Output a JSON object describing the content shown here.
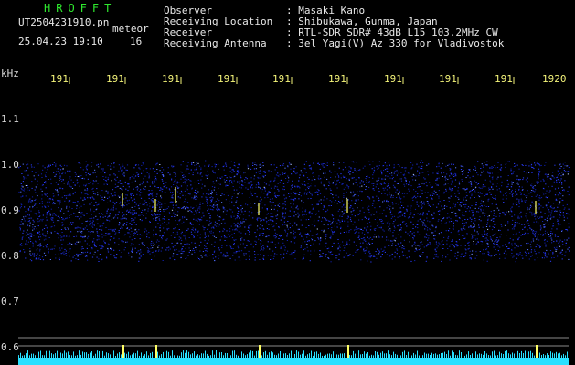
{
  "header": {
    "brand": "HROFFT",
    "filename": "UT2504231910.pn",
    "mode": "meteor",
    "datetime": "25.04.23 19:10",
    "count": "16",
    "info_labels": [
      "Observer",
      "Receiving Location",
      "Receiver",
      "Receiving Antenna"
    ],
    "info_values": [
      ": Masaki Kano",
      ": Shibukawa, Gunma, Japan",
      ": RTL-SDR SDR# 43dB L15 103.2MHz CW",
      ": 3el Yagi(V) Az 330 for Vladivostok"
    ]
  },
  "axis": {
    "unit": "kHz",
    "y_ticks": [
      "1.1",
      "1.0",
      "0.9",
      "0.8",
      "0.7",
      "0.6"
    ],
    "x_ticks": [
      "191",
      "191",
      "191",
      "191",
      "191",
      "191",
      "191",
      "191",
      "191",
      "1920"
    ]
  },
  "colors": {
    "noise_band": "#2a3cff",
    "meteor_echo": "#ffff66",
    "signal_bar": "#29e0ff",
    "ref_line": "#8a8a8a",
    "text_white": "#e8e8e8",
    "text_yellow": "#f4f47a",
    "brand_green": "#2ee82e"
  }
}
